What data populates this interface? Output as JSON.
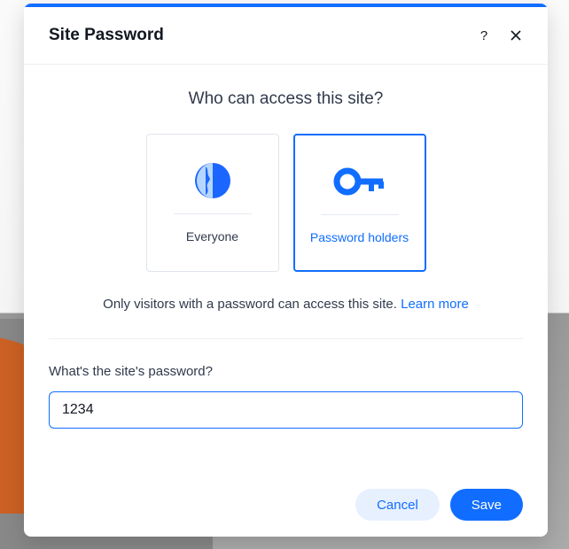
{
  "modal": {
    "title": "Site Password",
    "access_heading": "Who can access this site?",
    "option_everyone": "Everyone",
    "option_password_holders": "Password holders",
    "description_text": "Only visitors with a password can access this site. ",
    "learn_more": "Learn more",
    "password_label": "What's the site's password?",
    "password_value": "1234",
    "cancel": "Cancel",
    "save": "Save"
  }
}
